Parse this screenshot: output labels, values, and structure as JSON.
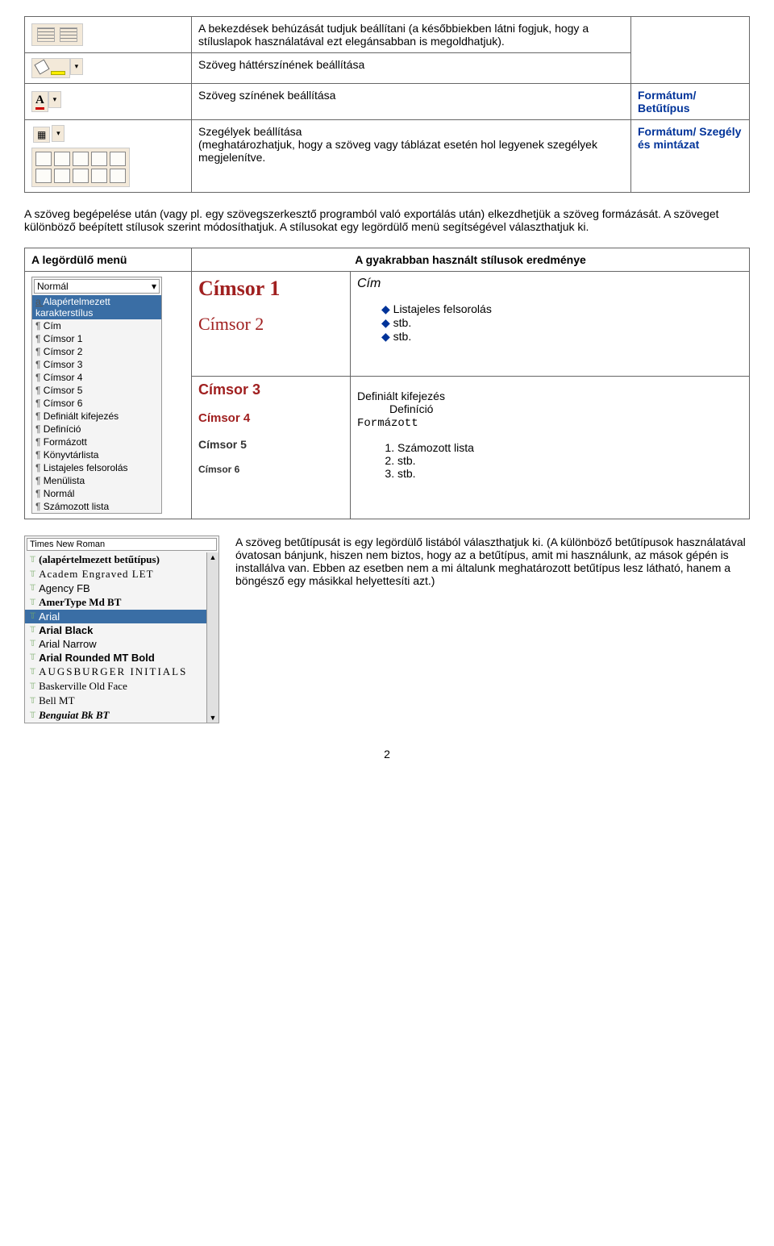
{
  "table1": {
    "rows": [
      {
        "desc": "A bekezdések behúzását tudjuk beállítani (a későbbiekben látni fogjuk, hogy a stíluslapok használatával ezt elegánsabban is megoldhatjuk).",
        "menu": ""
      },
      {
        "desc": "Szöveg háttérszínének beállítása",
        "menu": ""
      },
      {
        "desc": "Szöveg színének beállítása",
        "menu": "Formátum/ Betűtípus"
      },
      {
        "desc": "Szegélyek beállítása\n(meghatározhatjuk, hogy a szöveg vagy táblázat esetén hol legyenek szegélyek megjelenítve.",
        "menu": "Formátum/ Szegély és mintázat"
      }
    ]
  },
  "mid_para": "A szöveg begépelése után (vagy pl. egy szövegszerkesztő programból való exportálás után) elkezdhetjük a szöveg formázását. A szöveget különböző beépített stílusok szerint módosíthatjuk. A stílusokat egy legördülő menü segítségével választhatjuk ki.",
  "styles_table": {
    "col1_header": "A legördülő menü",
    "col2_header": "A gyakrabban használt stílusok eredménye",
    "dropdown_field": "Normál",
    "dropdown_items": [
      {
        "label": "Alapértelmezett karakterstílus",
        "selected": true,
        "prefix": "a"
      },
      {
        "label": "Cím",
        "prefix": "p"
      },
      {
        "label": "Címsor 1",
        "prefix": "p"
      },
      {
        "label": "Címsor 2",
        "prefix": "p"
      },
      {
        "label": "Címsor 3",
        "prefix": "p"
      },
      {
        "label": "Címsor 4",
        "prefix": "p"
      },
      {
        "label": "Címsor 5",
        "prefix": "p"
      },
      {
        "label": "Címsor 6",
        "prefix": "p"
      },
      {
        "label": "Definiált kifejezés",
        "prefix": "p"
      },
      {
        "label": "Definíció",
        "prefix": "p"
      },
      {
        "label": "Formázott",
        "prefix": "p"
      },
      {
        "label": "Könyvtárlista",
        "prefix": "p"
      },
      {
        "label": "Listajeles felsorolás",
        "prefix": "p"
      },
      {
        "label": "Menülista",
        "prefix": "p"
      },
      {
        "label": "Normál",
        "prefix": "p"
      },
      {
        "label": "Számozott lista",
        "prefix": "p"
      }
    ],
    "h1": "Címsor 1",
    "h2": "Címsor 2",
    "h3": "Címsor 3",
    "h4": "Címsor 4",
    "h5": "Címsor 5",
    "h6": "Címsor 6",
    "result": {
      "title": "Cím",
      "ul": [
        "Listajeles felsorolás",
        "stb.",
        "stb."
      ],
      "def_term": "Definiált kifejezés",
      "def_desc": "Definíció",
      "formatted": "Formázott",
      "ol": [
        "Számozott lista",
        "stb.",
        "stb."
      ]
    }
  },
  "font_section": {
    "text": "A szöveg betűtípusát is egy legördülő listából választhatjuk ki. (A különböző betűtípusok használatával óvatosan bánjunk, hiszen nem biztos, hogy az a betűtípus, amit mi használunk, az mások gépén is installálva van. Ebben az esetben nem a mi általunk meghatározott betűtípus lesz látható, hanem a böngésző egy másikkal helyettesíti azt.)",
    "field": "Times New Roman",
    "items": [
      {
        "label": "(alapértelmezett betűtípus)",
        "style": "font-family:serif;font-weight:bold"
      },
      {
        "label": "Academ Engraved LET",
        "style": "font-family:serif;letter-spacing:1px"
      },
      {
        "label": "Agency FB",
        "style": "font-family:'Arial Narrow',Arial;font-stretch:condensed"
      },
      {
        "label": "AmerType Md BT",
        "style": "font-family:serif;font-weight:bold"
      },
      {
        "label": "Arial",
        "selected": true,
        "style": "font-family:Arial"
      },
      {
        "label": "Arial Black",
        "style": "font-family:'Arial Black',Arial;font-weight:900"
      },
      {
        "label": "Arial Narrow",
        "style": "font-family:'Arial Narrow',Arial"
      },
      {
        "label": "Arial Rounded MT Bold",
        "style": "font-family:Arial;font-weight:bold"
      },
      {
        "label": "AUGSBURGER INITIALS",
        "style": "font-family:serif;letter-spacing:2px;font-variant:small-caps"
      },
      {
        "label": "Baskerville Old Face",
        "style": "font-family:'Baskerville',serif"
      },
      {
        "label": "Bell MT",
        "style": "font-family:serif"
      },
      {
        "label": "Benguiat Bk BT",
        "style": "font-family:serif;font-weight:bold;font-style:italic"
      }
    ]
  },
  "page_number": "2"
}
